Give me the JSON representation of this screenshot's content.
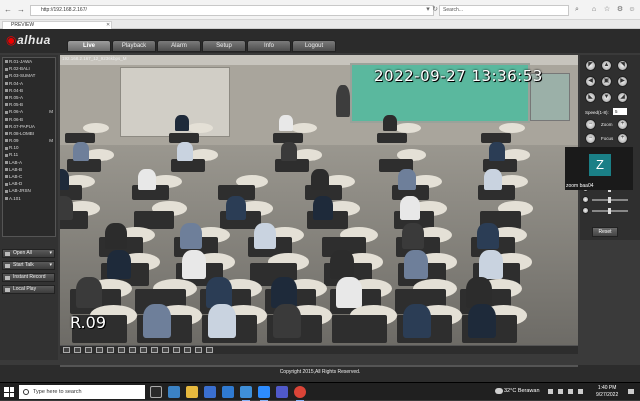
{
  "browser": {
    "url": "http://192.168.2.167/",
    "search_placeholder": "Search...",
    "tab_title": "PREVIEW"
  },
  "app": {
    "logo_left": "a",
    "logo_right": "lhua",
    "tabs": [
      "Live",
      "Playback",
      "Alarm",
      "Setup",
      "Info",
      "Logout"
    ],
    "active_tab": "Live"
  },
  "sidebar": {
    "cameras": [
      {
        "label": "R.01-JAWA",
        "m": ""
      },
      {
        "label": "R.02-BALI",
        "m": ""
      },
      {
        "label": "R.03-SUMAT",
        "m": ""
      },
      {
        "label": "R.04-A",
        "m": ""
      },
      {
        "label": "R.04-B",
        "m": ""
      },
      {
        "label": "R.05-A",
        "m": ""
      },
      {
        "label": "R.05-B",
        "m": ""
      },
      {
        "label": "R.06-A",
        "m": "M"
      },
      {
        "label": "R.06-B",
        "m": ""
      },
      {
        "label": "R.07-PAPUA",
        "m": ""
      },
      {
        "label": "R.08-LOMBI",
        "m": ""
      },
      {
        "label": "R.09",
        "m": "M"
      },
      {
        "label": "R.10",
        "m": ""
      },
      {
        "label": "R.11",
        "m": ""
      },
      {
        "label": "LAB-A",
        "m": ""
      },
      {
        "label": "LAB-B",
        "m": ""
      },
      {
        "label": "LAB-C",
        "m": ""
      },
      {
        "label": "LAB-D",
        "m": ""
      },
      {
        "label": "LAB-JRSN",
        "m": ""
      },
      {
        "label": "A.101",
        "m": ""
      }
    ],
    "buttons": [
      "Open All",
      "Start Talk",
      "Instant Record",
      "Local Play"
    ]
  },
  "video": {
    "header": "192.168.2.167_12_9236kbps_M",
    "timestamp": "2022-09-27 13:36:53",
    "camera_label": "R.09"
  },
  "ptz": {
    "speed_label": "Speed(1-8):",
    "speed_value": "5",
    "zoom_label": "Zoom",
    "focus_label": "Focus",
    "reset_label": "Reset"
  },
  "zoom_overlay": {
    "initial": "Z",
    "name": "zoom baa04"
  },
  "footer": {
    "copyright": "Copyright 2015,All Rights Reserved."
  },
  "taskbar": {
    "search_placeholder": "Type here to search",
    "weather": "32°C Berawan",
    "time": "1:40 PM",
    "date": "9/27/2022"
  }
}
